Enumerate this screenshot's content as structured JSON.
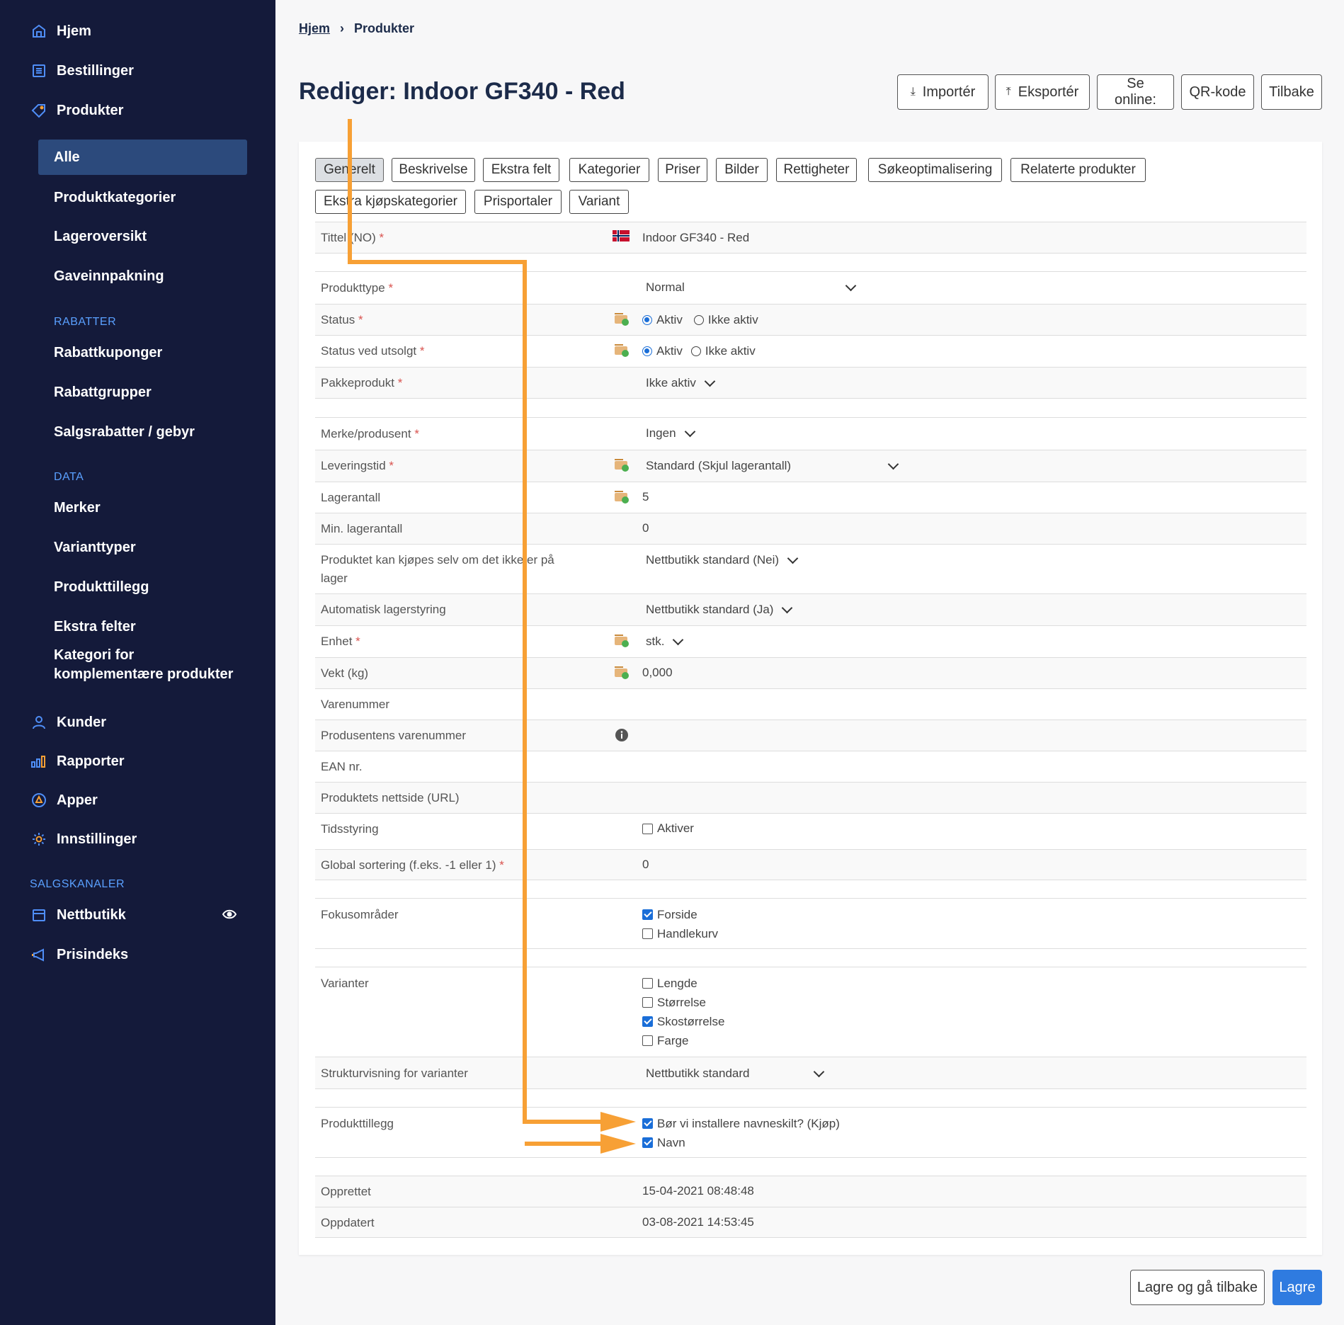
{
  "sidebar": {
    "home": "Hjem",
    "orders": "Bestillinger",
    "products": "Produkter",
    "products_sub": [
      "Alle",
      "Produktkategorier",
      "Lageroversikt",
      "Gaveinnpakning"
    ],
    "discounts_header": "RABATTER",
    "discounts": [
      "Rabattkuponger",
      "Rabattgrupper",
      "Salgsrabatter / gebyr"
    ],
    "data_header": "DATA",
    "data": [
      "Merker",
      "Varianttyper",
      "Produkttillegg",
      "Ekstra felter"
    ],
    "complementary_line1": "Kategori for",
    "complementary_line2": "komplementære produkter",
    "customers": "Kunder",
    "reports": "Rapporter",
    "apps": "Apper",
    "settings": "Innstillinger",
    "channels_header": "SALGSKANALER",
    "webshop": "Nettbutikk",
    "price_index": "Prisindeks",
    "accent_color": "#4f8ef7",
    "background_color": "#141a3a"
  },
  "breadcrumb": {
    "home": "Hjem",
    "current": "Produkter"
  },
  "page_title": "Rediger: Indoor GF340 - Red",
  "actions": {
    "import": "Importér",
    "export": "Eksportér",
    "view_online": "Se online:",
    "qr": "QR-kode",
    "back": "Tilbake"
  },
  "tabs": [
    "Generelt",
    "Beskrivelse",
    "Ekstra felt",
    "Kategorier",
    "Priser",
    "Bilder",
    "Rettigheter",
    "Søkeoptimalisering",
    "Relaterte produkter",
    "Ekstra kjøpskategorier",
    "Prisportaler",
    "Variant"
  ],
  "form": {
    "title_label": "Tittel (NO)",
    "title_value": "Indoor GF340 - Red",
    "product_type_label": "Produkttype",
    "product_type_value": "Normal",
    "status_label": "Status",
    "status_on": "Aktiv",
    "status_off": "Ikke aktiv",
    "status_sold_out_label": "Status ved utsolgt",
    "status_sold_out_on": "Aktiv",
    "status_sold_out_off": "Ikke aktiv",
    "package_label": "Pakkeprodukt",
    "package_value": "Ikke aktiv",
    "brand_label": "Merke/produsent",
    "brand_value": "Ingen",
    "delivery_label": "Leveringstid",
    "delivery_value": "Standard (Skjul lagerantall)",
    "stock_label": "Lagerantall",
    "stock_value": "5",
    "min_stock_label": "Min. lagerantall",
    "min_stock_value": "0",
    "backorder_label_1": "Produktet kan kjøpes selv om det ikke er på",
    "backorder_label_2": "lager",
    "backorder_value": "Nettbutikk standard (Nei)",
    "auto_stock_label": "Automatisk lagerstyring",
    "auto_stock_value": "Nettbutikk standard (Ja)",
    "unit_label": "Enhet",
    "unit_value": "stk.",
    "weight_label": "Vekt (kg)",
    "weight_value": "0,000",
    "item_no_label": "Varenummer",
    "mfr_item_no_label": "Produsentens varenummer",
    "ean_label": "EAN nr.",
    "url_label": "Produktets nettside (URL)",
    "time_label": "Tidsstyring",
    "time_value": "Aktiver",
    "sort_label": "Global sortering (f.eks. -1 eller 1)",
    "sort_value": "0",
    "focus_label": "Fokusområder",
    "focus_options": [
      "Forside",
      "Handlekurv"
    ],
    "variants_label": "Varianter",
    "variants_options": [
      "Lengde",
      "Størrelse",
      "Skostørrelse",
      "Farge"
    ],
    "structure_label": "Strukturvisning for varianter",
    "structure_value": "Nettbutikk standard",
    "addons_label": "Produkttillegg",
    "addons_options": [
      "Bør vi installere navneskilt? (Kjøp)",
      "Navn"
    ],
    "created_label": "Opprettet",
    "created_value": "15-04-2021 08:48:48",
    "updated_label": "Oppdatert",
    "updated_value": "03-08-2021 14:53:45",
    "required_mark": "*"
  },
  "checked": {
    "focus": [
      true,
      false
    ],
    "variants": [
      false,
      false,
      true,
      false
    ],
    "addons": [
      true,
      true
    ]
  },
  "footer": {
    "save_back": "Lagre og gå tilbake",
    "save": "Lagre"
  },
  "colors": {
    "primary": "#1a6ed8",
    "annotation": "#f7a035",
    "required": "#d9534f"
  }
}
